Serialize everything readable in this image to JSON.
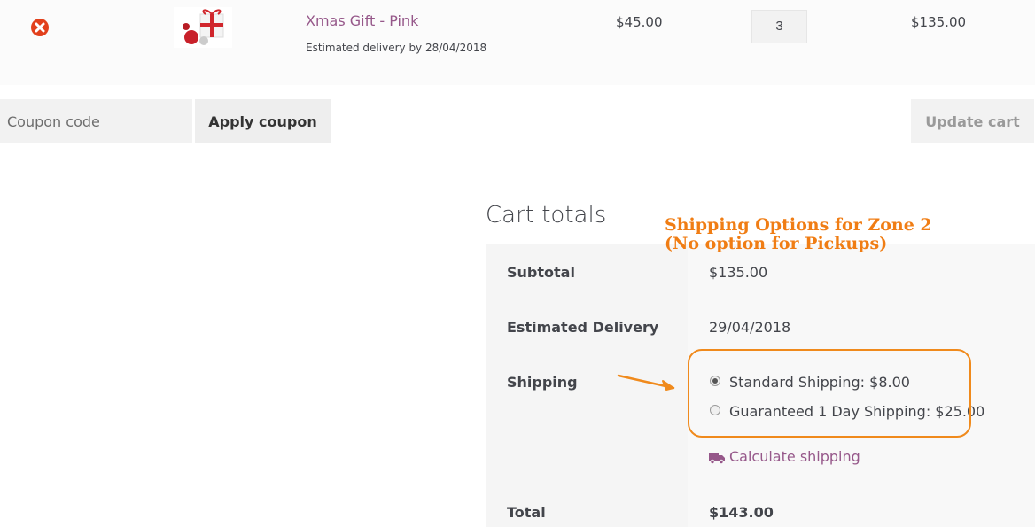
{
  "cart_item": {
    "remove_icon": "close-circle-icon",
    "product_name": "Xmas Gift - Pink",
    "delivery_note": "Estimated delivery by 28/04/2018",
    "unit_price": "$45.00",
    "quantity": "3",
    "subtotal": "$135.00"
  },
  "coupon": {
    "placeholder": "Coupon code",
    "apply_label": "Apply coupon",
    "update_label": "Update cart"
  },
  "totals": {
    "title": "Cart totals",
    "subtotal_label": "Subtotal",
    "subtotal_value": "$135.00",
    "estimated_delivery_label": "Estimated Delivery",
    "estimated_delivery_value": "29/04/2018",
    "shipping_label": "Shipping",
    "shipping_options": [
      {
        "label": "Standard Shipping: $8.00",
        "selected": true
      },
      {
        "label": "Guaranteed 1 Day Shipping: $25.00",
        "selected": false
      }
    ],
    "calculate_shipping": "Calculate shipping",
    "total_label": "Total",
    "total_value": "$143.00"
  },
  "annotation": {
    "line1": "Shipping Options for Zone 2",
    "line2": "(No option for Pickups)"
  },
  "colors": {
    "link": "#96588a",
    "annotation": "#f07d14",
    "remove": "#e2401c"
  }
}
